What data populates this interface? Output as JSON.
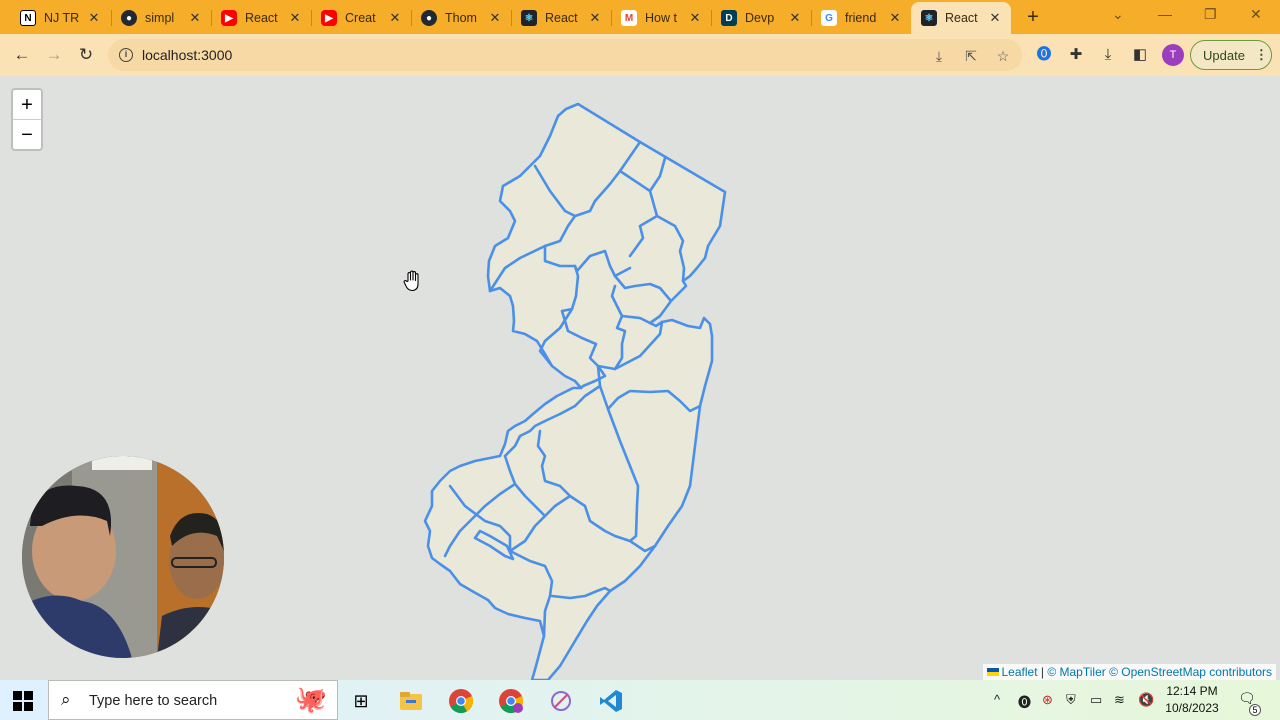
{
  "browser": {
    "tabs": [
      {
        "title": "NJ TR",
        "icon": "notion-icon",
        "color": "#ffffff"
      },
      {
        "title": "simpl",
        "icon": "github-icon",
        "color": "#24292f"
      },
      {
        "title": "React",
        "icon": "youtube-icon",
        "color": "#ff0000"
      },
      {
        "title": "Creat",
        "icon": "youtube-icon",
        "color": "#ff0000"
      },
      {
        "title": "Thom",
        "icon": "github-icon",
        "color": "#24292f"
      },
      {
        "title": "React",
        "icon": "react-icon",
        "color": "#20232a"
      },
      {
        "title": "How t",
        "icon": "gmail-icon",
        "color": "#ea4335"
      },
      {
        "title": "Devp",
        "icon": "devpost-icon",
        "color": "#003e54"
      },
      {
        "title": "friend",
        "icon": "google-icon",
        "color": "#4285f4"
      },
      {
        "title": "React",
        "icon": "react-icon",
        "color": "#20232a",
        "active": true
      }
    ],
    "url": "localhost:3000",
    "update_label": "Update",
    "profile_initial": "T",
    "accent": "#f6ad2a"
  },
  "map": {
    "zoom_in_label": "+",
    "zoom_out_label": "−",
    "outline_color": "#4a90e8",
    "fill_color": "#e9e8d9",
    "attribution": {
      "leaflet": "Leaflet",
      "separator": " | ",
      "maptiler": "© MapTiler",
      "osm": "© OpenStreetMap contributors"
    }
  },
  "taskbar": {
    "search_placeholder": "Type here to search",
    "time": "12:14 PM",
    "date": "10/8/2023",
    "notification_count": "5"
  }
}
